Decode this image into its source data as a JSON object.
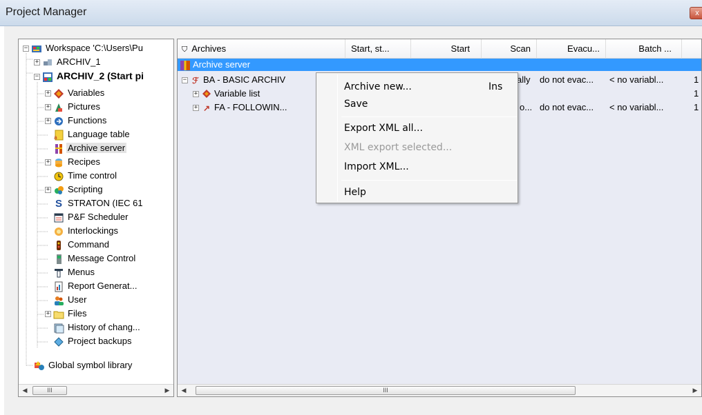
{
  "window": {
    "title": "Project Manager",
    "close_glyph": "x"
  },
  "tree": {
    "items": [
      {
        "label": "Workspace 'C:\\Users\\Pu",
        "icon": "workspace-icon",
        "expander": "−"
      },
      {
        "label": "ARCHIV_1",
        "icon": "project-icon",
        "expander": "+"
      },
      {
        "label": "ARCHIV_2 (Start pi",
        "icon": "project-active-icon",
        "expander": "−"
      },
      {
        "label": "Variables",
        "icon": "variables-icon",
        "expander": "+"
      },
      {
        "label": "Pictures",
        "icon": "pictures-icon",
        "expander": "+"
      },
      {
        "label": "Functions",
        "icon": "functions-icon",
        "expander": "+"
      },
      {
        "label": "Language table",
        "icon": "language-table-icon",
        "expander": ""
      },
      {
        "label": "Archive server",
        "icon": "archive-server-icon",
        "expander": ""
      },
      {
        "label": "Recipes",
        "icon": "recipes-icon",
        "expander": "+"
      },
      {
        "label": "Time control",
        "icon": "time-control-icon",
        "expander": ""
      },
      {
        "label": "Scripting",
        "icon": "scripting-icon",
        "expander": "+"
      },
      {
        "label": "STRATON (IEC 61",
        "icon": "straton-icon",
        "expander": ""
      },
      {
        "label": "P&F Scheduler",
        "icon": "scheduler-icon",
        "expander": ""
      },
      {
        "label": "Interlockings",
        "icon": "interlockings-icon",
        "expander": ""
      },
      {
        "label": "Command",
        "icon": "command-icon",
        "expander": ""
      },
      {
        "label": "Message Control",
        "icon": "message-control-icon",
        "expander": ""
      },
      {
        "label": "Menus",
        "icon": "menus-icon",
        "expander": ""
      },
      {
        "label": "Report Generat...",
        "icon": "report-generator-icon",
        "expander": ""
      },
      {
        "label": "User",
        "icon": "user-icon",
        "expander": ""
      },
      {
        "label": "Files",
        "icon": "folder-icon",
        "expander": "+"
      },
      {
        "label": "History of chang...",
        "icon": "history-icon",
        "expander": ""
      },
      {
        "label": "Project backups",
        "icon": "backup-icon",
        "expander": ""
      },
      {
        "label": "Global symbol library",
        "icon": "symbol-library-icon",
        "expander": ""
      }
    ],
    "scroll_thumb": "III"
  },
  "archives": {
    "columns": [
      "Archives",
      "Start, st...",
      "Start",
      "Scan",
      "Evacu...",
      "Batch ..."
    ],
    "selected_row": "Archive server",
    "rows": [
      {
        "name": "BA - BASIC ARCHIV",
        "scan": "ally",
        "evac": "do not evac...",
        "batch": "< no variabl...",
        "extra": "1"
      },
      {
        "name": "Variable list",
        "scan": "",
        "evac": "",
        "batch": "",
        "extra": "1"
      },
      {
        "name": "FA - FOLLOWIN...",
        "scan": "o...",
        "evac": "do not evac...",
        "batch": "< no variabl...",
        "extra": "1"
      }
    ],
    "scroll_thumb": "III"
  },
  "context_menu": {
    "items": [
      {
        "label": "Archive new...",
        "shortcut": "Ins",
        "disabled": false
      },
      {
        "label": "Save",
        "shortcut": "",
        "disabled": false
      },
      {
        "label": "Export XML all...",
        "shortcut": "",
        "disabled": false
      },
      {
        "label": "XML export selected...",
        "shortcut": "",
        "disabled": true
      },
      {
        "label": "Import XML...",
        "shortcut": "",
        "disabled": false
      },
      {
        "label": "Help",
        "shortcut": "",
        "disabled": false
      }
    ]
  },
  "colors": {
    "selection": "#3399ff",
    "list_background": "#e9ebf4",
    "menu_background": "#f5f5f5"
  }
}
